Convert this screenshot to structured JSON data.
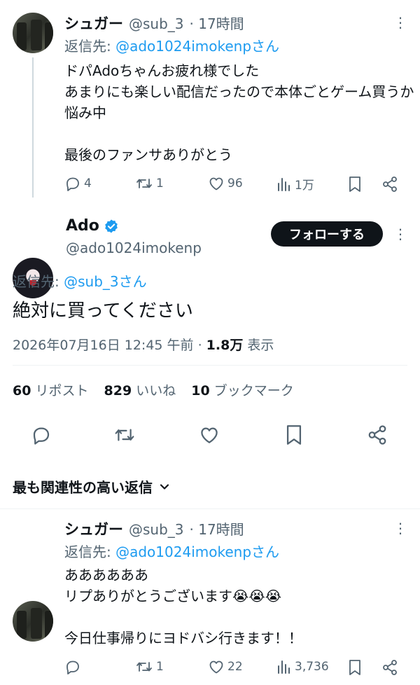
{
  "reply1": {
    "name": "シュガー",
    "handle": "@sub_3",
    "time": "· 17時間",
    "reply_prefix": "返信先: ",
    "reply_to": "@ado1024imokenpさん",
    "text": "ドパAdoちゃんお疲れ様でした\nあまりにも楽しい配信だったので本体ごとゲーム買うか悩み中\n\n最後のファンサありがとう",
    "replies": "4",
    "reposts": "1",
    "likes": "96",
    "views": "1万"
  },
  "main": {
    "name": "Ado",
    "handle": "@ado1024imokenp",
    "follow_label": "フォローする",
    "reply_prefix": "返信先: ",
    "reply_to": "@sub_3さん",
    "text": "絶対に買ってください",
    "timestamp": "2026年07月16日 12:45 午前 · ",
    "views_count": "1.8万",
    "views_label": " 表示",
    "reposts_count": "60",
    "reposts_label": " リポスト",
    "likes_count": "829",
    "likes_label": " いいね",
    "bookmarks_count": "10",
    "bookmarks_label": " ブックマーク"
  },
  "sort": {
    "label": "最も関連性の高い返信"
  },
  "reply2": {
    "name": "シュガー",
    "handle": "@sub_3",
    "time": "· 17時間",
    "reply_prefix": "返信先: ",
    "reply_to": "@ado1024imokenpさん",
    "text": "ああああああ\nリプありがとうございます😭😭😭\n\n今日仕事帰りにヨドバシ行きます！！",
    "replies": "",
    "reposts": "1",
    "likes": "22",
    "views": "3,736"
  },
  "colors": {
    "link": "#1d9bf0",
    "secondary": "#536471",
    "primary": "#0f1419",
    "verified": "#1d9bf0"
  },
  "icons": [
    "reply-icon",
    "repost-icon",
    "like-icon",
    "views-icon",
    "bookmark-icon",
    "share-icon",
    "more-icon",
    "verified-icon",
    "chevron-down-icon"
  ]
}
